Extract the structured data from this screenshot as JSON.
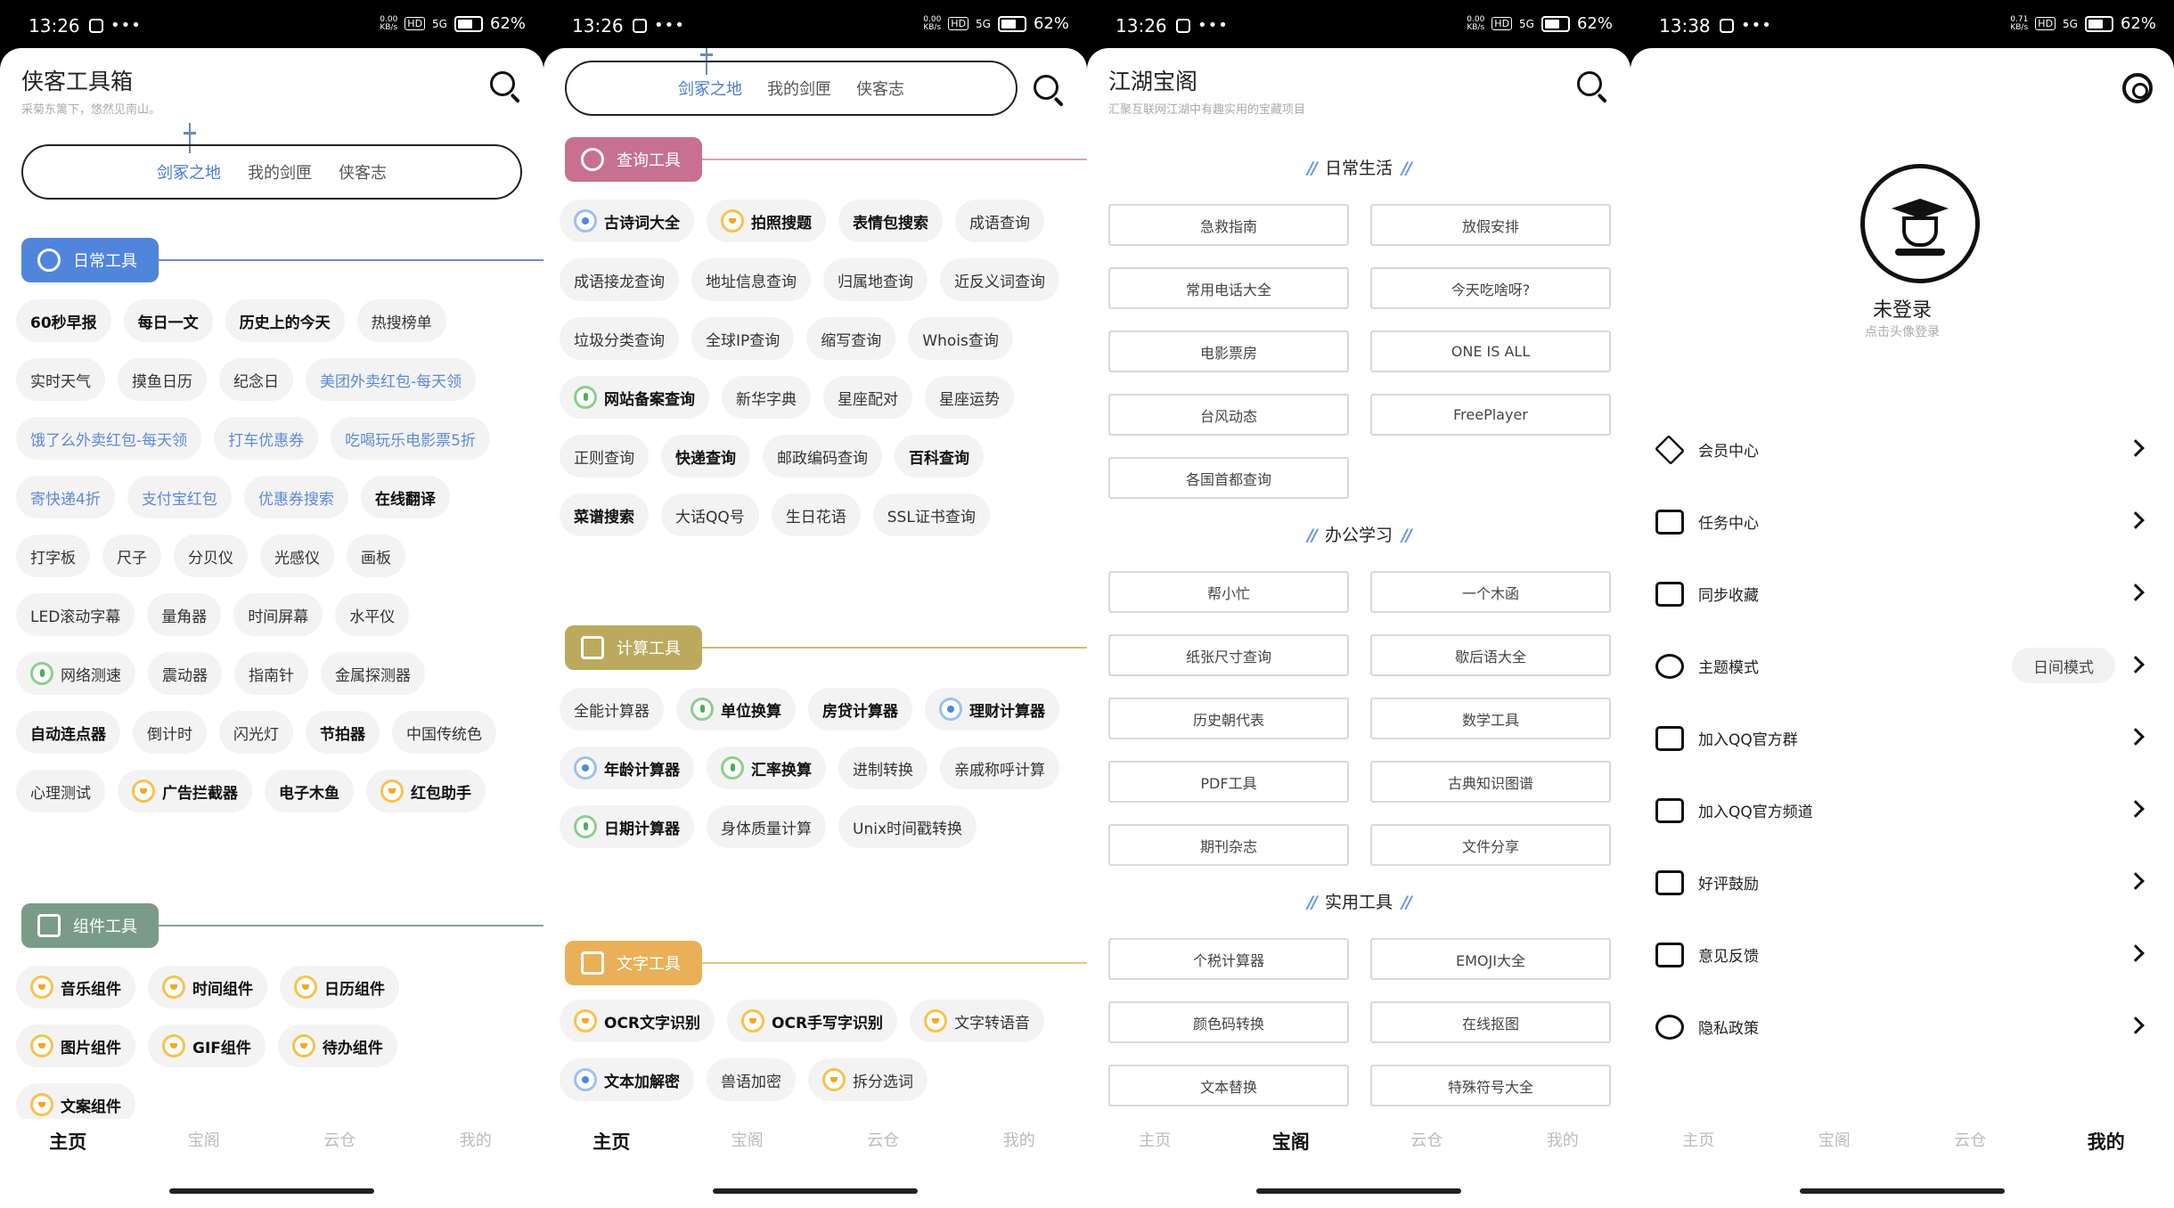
{
  "status": {
    "screen1_time": "13:26",
    "screen2_time": "13:26",
    "screen3_time": "13:26",
    "screen4_time": "13:38",
    "battery": "62%",
    "speed1": "0.00",
    "speed4": "0.71",
    "speed_unit": "KB/s",
    "hd": "HD",
    "net": "5G"
  },
  "nav": {
    "home": "主页",
    "treasure": "宝阁",
    "cloud": "云仓",
    "mine": "我的"
  },
  "screen1": {
    "title": "侠客工具箱",
    "subtitle": "采菊东篱下，悠然见南山。",
    "tabs": [
      "剑冢之地",
      "我的剑匣",
      "侠客志"
    ],
    "section_daily": "日常工具",
    "daily_tools": [
      {
        "label": "60秒早报",
        "style": "bold"
      },
      {
        "label": "每日一文",
        "style": "bold"
      },
      {
        "label": "历史上的今天",
        "style": "bold"
      },
      {
        "label": "热搜榜单",
        "style": "normal"
      },
      {
        "label": "实时天气",
        "style": "normal"
      },
      {
        "label": "摸鱼日历",
        "style": "normal"
      },
      {
        "label": "纪念日",
        "style": "normal"
      },
      {
        "label": "美团外卖红包-每天领",
        "style": "blue"
      },
      {
        "label": "饿了么外卖红包-每天领",
        "style": "blue"
      },
      {
        "label": "打车优惠券",
        "style": "blue"
      },
      {
        "label": "吃喝玩乐电影票5折",
        "style": "blue"
      },
      {
        "label": "寄快递4折",
        "style": "blue"
      },
      {
        "label": "支付宝红包",
        "style": "blue"
      },
      {
        "label": "优惠券搜索",
        "style": "blue"
      },
      {
        "label": "在线翻译",
        "style": "bold"
      },
      {
        "label": "打字板",
        "style": "normal"
      },
      {
        "label": "尺子",
        "style": "normal"
      },
      {
        "label": "分贝仪",
        "style": "normal"
      },
      {
        "label": "光感仪",
        "style": "normal"
      },
      {
        "label": "画板",
        "style": "normal"
      },
      {
        "label": "LED滚动字幕",
        "style": "normal"
      },
      {
        "label": "量角器",
        "style": "normal"
      },
      {
        "label": "时间屏幕",
        "style": "normal"
      },
      {
        "label": "水平仪",
        "style": "normal"
      },
      {
        "label": "网络测速",
        "style": "normal",
        "badge": "green"
      },
      {
        "label": "震动器",
        "style": "normal"
      },
      {
        "label": "指南针",
        "style": "normal"
      },
      {
        "label": "金属探测器",
        "style": "normal"
      },
      {
        "label": "自动连点器",
        "style": "bold"
      },
      {
        "label": "倒计时",
        "style": "normal"
      },
      {
        "label": "闪光灯",
        "style": "normal"
      },
      {
        "label": "节拍器",
        "style": "bold"
      },
      {
        "label": "中国传统色",
        "style": "normal"
      },
      {
        "label": "心理测试",
        "style": "normal"
      },
      {
        "label": "广告拦截器",
        "style": "bold",
        "badge": "gold"
      },
      {
        "label": "电子木鱼",
        "style": "bold"
      },
      {
        "label": "红包助手",
        "style": "bold",
        "badge": "gold"
      }
    ],
    "section_widgets": "组件工具",
    "widget_tools": [
      {
        "label": "音乐组件",
        "style": "bold",
        "badge": "gold"
      },
      {
        "label": "时间组件",
        "style": "bold",
        "badge": "gold"
      },
      {
        "label": "日历组件",
        "style": "bold",
        "badge": "gold"
      },
      {
        "label": "图片组件",
        "style": "bold",
        "badge": "gold"
      },
      {
        "label": "GIF组件",
        "style": "bold",
        "badge": "gold"
      },
      {
        "label": "待办组件",
        "style": "bold",
        "badge": "gold"
      },
      {
        "label": "文案组件",
        "style": "bold",
        "badge": "gold"
      }
    ]
  },
  "screen2": {
    "tabs": [
      "剑冢之地",
      "我的剑匣",
      "侠客志"
    ],
    "section_query": "查询工具",
    "query_tools": [
      {
        "label": "古诗词大全",
        "style": "bold",
        "badge": "blue"
      },
      {
        "label": "拍照搜题",
        "style": "bold",
        "badge": "gold"
      },
      {
        "label": "表情包搜索",
        "style": "bold"
      },
      {
        "label": "成语查询",
        "style": "normal"
      },
      {
        "label": "成语接龙查询",
        "style": "normal"
      },
      {
        "label": "地址信息查询",
        "style": "normal"
      },
      {
        "label": "归属地查询",
        "style": "normal"
      },
      {
        "label": "近反义词查询",
        "style": "normal"
      },
      {
        "label": "垃圾分类查询",
        "style": "normal"
      },
      {
        "label": "全球IP查询",
        "style": "normal"
      },
      {
        "label": "缩写查询",
        "style": "normal"
      },
      {
        "label": "Whois查询",
        "style": "normal"
      },
      {
        "label": "网站备案查询",
        "style": "bold",
        "badge": "green"
      },
      {
        "label": "新华字典",
        "style": "normal"
      },
      {
        "label": "星座配对",
        "style": "normal"
      },
      {
        "label": "星座运势",
        "style": "normal"
      },
      {
        "label": "正则查询",
        "style": "normal"
      },
      {
        "label": "快递查询",
        "style": "bold"
      },
      {
        "label": "邮政编码查询",
        "style": "normal"
      },
      {
        "label": "百科查询",
        "style": "bold"
      },
      {
        "label": "菜谱搜索",
        "style": "bold"
      },
      {
        "label": "大话QQ号",
        "style": "normal"
      },
      {
        "label": "生日花语",
        "style": "normal"
      },
      {
        "label": "SSL证书查询",
        "style": "normal"
      }
    ],
    "section_calc": "计算工具",
    "calc_tools": [
      {
        "label": "全能计算器",
        "style": "normal"
      },
      {
        "label": "单位换算",
        "style": "bold",
        "badge": "green"
      },
      {
        "label": "房贷计算器",
        "style": "bold"
      },
      {
        "label": "理财计算器",
        "style": "bold",
        "badge": "blue"
      },
      {
        "label": "年龄计算器",
        "style": "bold",
        "badge": "blue"
      },
      {
        "label": "汇率换算",
        "style": "bold",
        "badge": "green"
      },
      {
        "label": "进制转换",
        "style": "normal"
      },
      {
        "label": "亲戚称呼计算",
        "style": "normal"
      },
      {
        "label": "日期计算器",
        "style": "bold",
        "badge": "green"
      },
      {
        "label": "身体质量计算",
        "style": "normal"
      },
      {
        "label": "Unix时间戳转换",
        "style": "normal"
      }
    ],
    "section_text": "文字工具",
    "text_tools": [
      {
        "label": "OCR文字识别",
        "style": "bold",
        "badge": "gold"
      },
      {
        "label": "OCR手写字识别",
        "style": "bold",
        "badge": "gold"
      },
      {
        "label": "文字转语音",
        "style": "normal",
        "badge": "gold"
      },
      {
        "label": "文本加解密",
        "style": "bold",
        "badge": "blue"
      },
      {
        "label": "兽语加密",
        "style": "normal"
      },
      {
        "label": "拆分选词",
        "style": "normal",
        "badge": "gold"
      }
    ]
  },
  "screen3": {
    "title": "江湖宝阁",
    "subtitle": "汇聚互联网江湖中有趣实用的宝藏项目",
    "cat_daily": "日常生活",
    "daily_items": [
      "急救指南",
      "放假安排",
      "常用电话大全",
      "今天吃啥呀?",
      "电影票房",
      "ONE  IS ALL",
      "台风动态",
      "FreePlayer",
      "各国首都查询"
    ],
    "cat_office": "办公学习",
    "office_items": [
      "帮小忙",
      "一个木函",
      "纸张尺寸查询",
      "歇后语大全",
      "历史朝代表",
      "数学工具",
      "PDF工具",
      "古典知识图谱",
      "期刊杂志",
      "文件分享"
    ],
    "cat_util": "实用工具",
    "util_items": [
      "个税计算器",
      "EMOJI大全",
      "颜色码转换",
      "在线抠图",
      "文本替换",
      "特殊符号大全"
    ]
  },
  "screen4": {
    "login_name": "未登录",
    "login_hint": "点击头像登录",
    "theme_value": "日间模式",
    "menu": [
      "会员中心",
      "任务中心",
      "同步收藏",
      "主题模式",
      "加入QQ官方群",
      "加入QQ官方频道",
      "好评鼓励",
      "意见反馈",
      "隐私政策"
    ],
    "menu_icons": [
      "diamond-icon",
      "task-icon",
      "sync-icon",
      "theme-icon",
      "group-icon",
      "channel-icon",
      "thumbs-up-icon",
      "feedback-icon",
      "privacy-icon"
    ]
  }
}
